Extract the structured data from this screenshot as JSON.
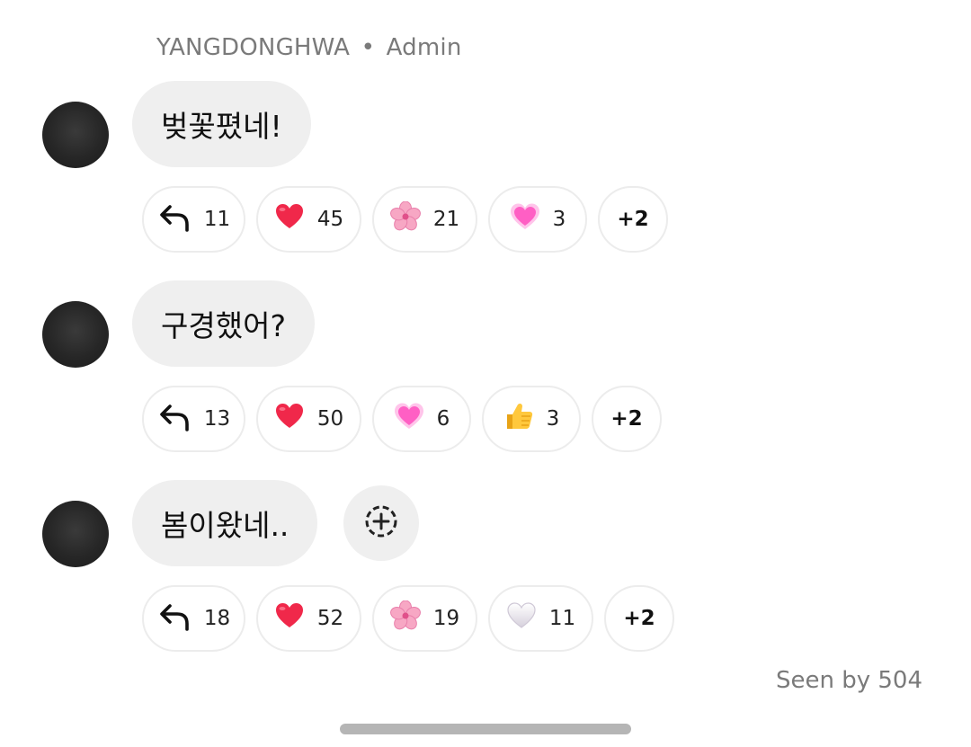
{
  "header": {
    "sender_name": "YANGDONGHWA",
    "separator": "•",
    "role": "Admin"
  },
  "messages": [
    {
      "text": "벚꽃폈네!",
      "reactions": [
        {
          "icon": "reply-arrow-icon",
          "count": "11"
        },
        {
          "icon": "red-heart-icon",
          "count": "45"
        },
        {
          "icon": "cherry-blossom-icon",
          "count": "21"
        },
        {
          "icon": "growing-heart-icon",
          "count": "3"
        }
      ],
      "more": "+2"
    },
    {
      "text": "구경했어?",
      "reactions": [
        {
          "icon": "reply-arrow-icon",
          "count": "13"
        },
        {
          "icon": "red-heart-icon",
          "count": "50"
        },
        {
          "icon": "growing-heart-icon",
          "count": "6"
        },
        {
          "icon": "thumbs-up-icon",
          "count": "3"
        }
      ],
      "more": "+2"
    },
    {
      "text": "봄이왔네..",
      "reactions": [
        {
          "icon": "reply-arrow-icon",
          "count": "18"
        },
        {
          "icon": "red-heart-icon",
          "count": "52"
        },
        {
          "icon": "cherry-blossom-icon",
          "count": "19"
        },
        {
          "icon": "white-heart-icon",
          "count": "11"
        }
      ],
      "more": "+2"
    }
  ],
  "seen": "Seen by 504",
  "colors": {
    "bubble": "#efefef",
    "chip_border": "#ececec",
    "meta_text": "#7a7a7a",
    "heart": "#f0284a",
    "blossom": "#f7a7c4",
    "pink_heart": "#ff5fc4"
  }
}
